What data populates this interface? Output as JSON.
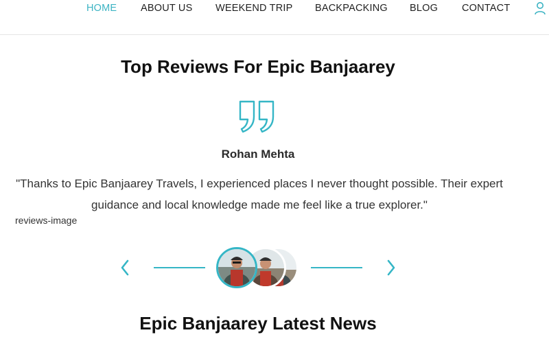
{
  "nav": {
    "items": [
      {
        "label": "HOME",
        "active": true
      },
      {
        "label": "ABOUT US",
        "active": false
      },
      {
        "label": "WEEKEND TRIP",
        "active": false
      },
      {
        "label": "BACKPACKING",
        "active": false
      },
      {
        "label": "BLOG",
        "active": false
      },
      {
        "label": "CONTACT",
        "active": false
      }
    ],
    "user_icon": "user-icon"
  },
  "reviews": {
    "title": "Top Reviews For Epic Banjaarey",
    "quote_icon": "quote-icon",
    "reviewer_name": "Rohan Mehta",
    "review_text": "\"Thanks to Epic Banjaarey Travels, I experienced places I never thought possible. Their expert guidance and local knowledge made me feel like a true explorer.\"",
    "image_alt": "reviews-image",
    "slider": {
      "prev_icon": "chevron-left-icon",
      "next_icon": "chevron-right-icon",
      "avatars": [
        "reviewer-avatar-1",
        "reviewer-avatar-2",
        "reviewer-avatar-3"
      ],
      "active_index": 0
    }
  },
  "news": {
    "title": "Epic Banjaarey Latest News"
  },
  "colors": {
    "accent": "#35b6c6",
    "nav_active": "#3bb3c3",
    "text": "#222222"
  }
}
